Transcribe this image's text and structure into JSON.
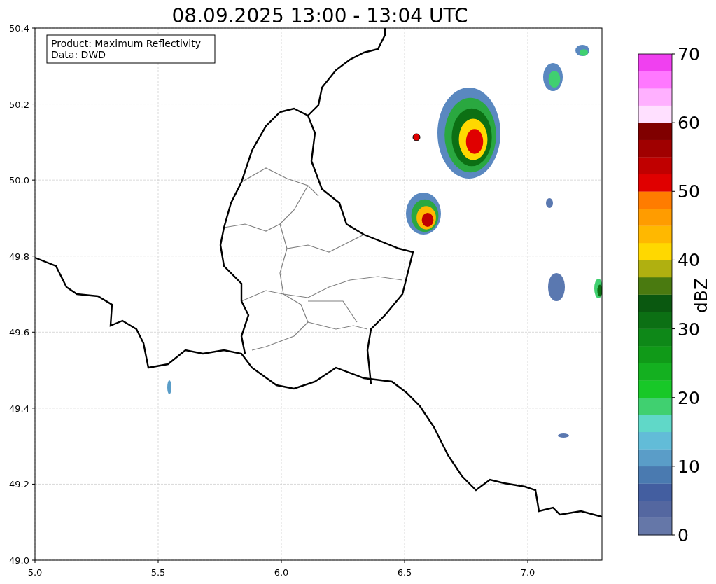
{
  "title": "08.09.2025 13:00 - 13:04 UTC",
  "info_box": [
    "Product: Maximum Reflectivity",
    "Data: DWD"
  ],
  "x_ticks": [
    "5.0",
    "5.5",
    "6.0",
    "6.5",
    "7.0"
  ],
  "y_ticks": [
    "50.4",
    "50.2",
    "50.0",
    "49.8",
    "49.6",
    "49.4",
    "49.2",
    "49.0"
  ],
  "colorbar": {
    "label": "dBZ",
    "ticks": [
      "70",
      "60",
      "50",
      "40",
      "30",
      "20",
      "10",
      "0"
    ],
    "bins": [
      {
        "color": "#6577a8"
      },
      {
        "color": "#5467a0"
      },
      {
        "color": "#435ea0"
      },
      {
        "color": "#4a7ab0"
      },
      {
        "color": "#5a9dc8"
      },
      {
        "color": "#62bcd8"
      },
      {
        "color": "#60d8c8"
      },
      {
        "color": "#40d070"
      },
      {
        "color": "#18c828"
      },
      {
        "color": "#14b020"
      },
      {
        "color": "#109a18"
      },
      {
        "color": "#0e8818"
      },
      {
        "color": "#0c7014"
      },
      {
        "color": "#0a5810"
      },
      {
        "color": "#4a7a10"
      },
      {
        "color": "#b0b010"
      },
      {
        "color": "#ffd800"
      },
      {
        "color": "#ffb800"
      },
      {
        "color": "#ff9c00"
      },
      {
        "color": "#ff7c00"
      },
      {
        "color": "#e00000"
      },
      {
        "color": "#c00000"
      },
      {
        "color": "#a00000"
      },
      {
        "color": "#800000"
      },
      {
        "color": "#ffe0ff"
      },
      {
        "color": "#ffb0ff"
      },
      {
        "color": "#ff78ff"
      },
      {
        "color": "#f040f0"
      }
    ]
  }
}
